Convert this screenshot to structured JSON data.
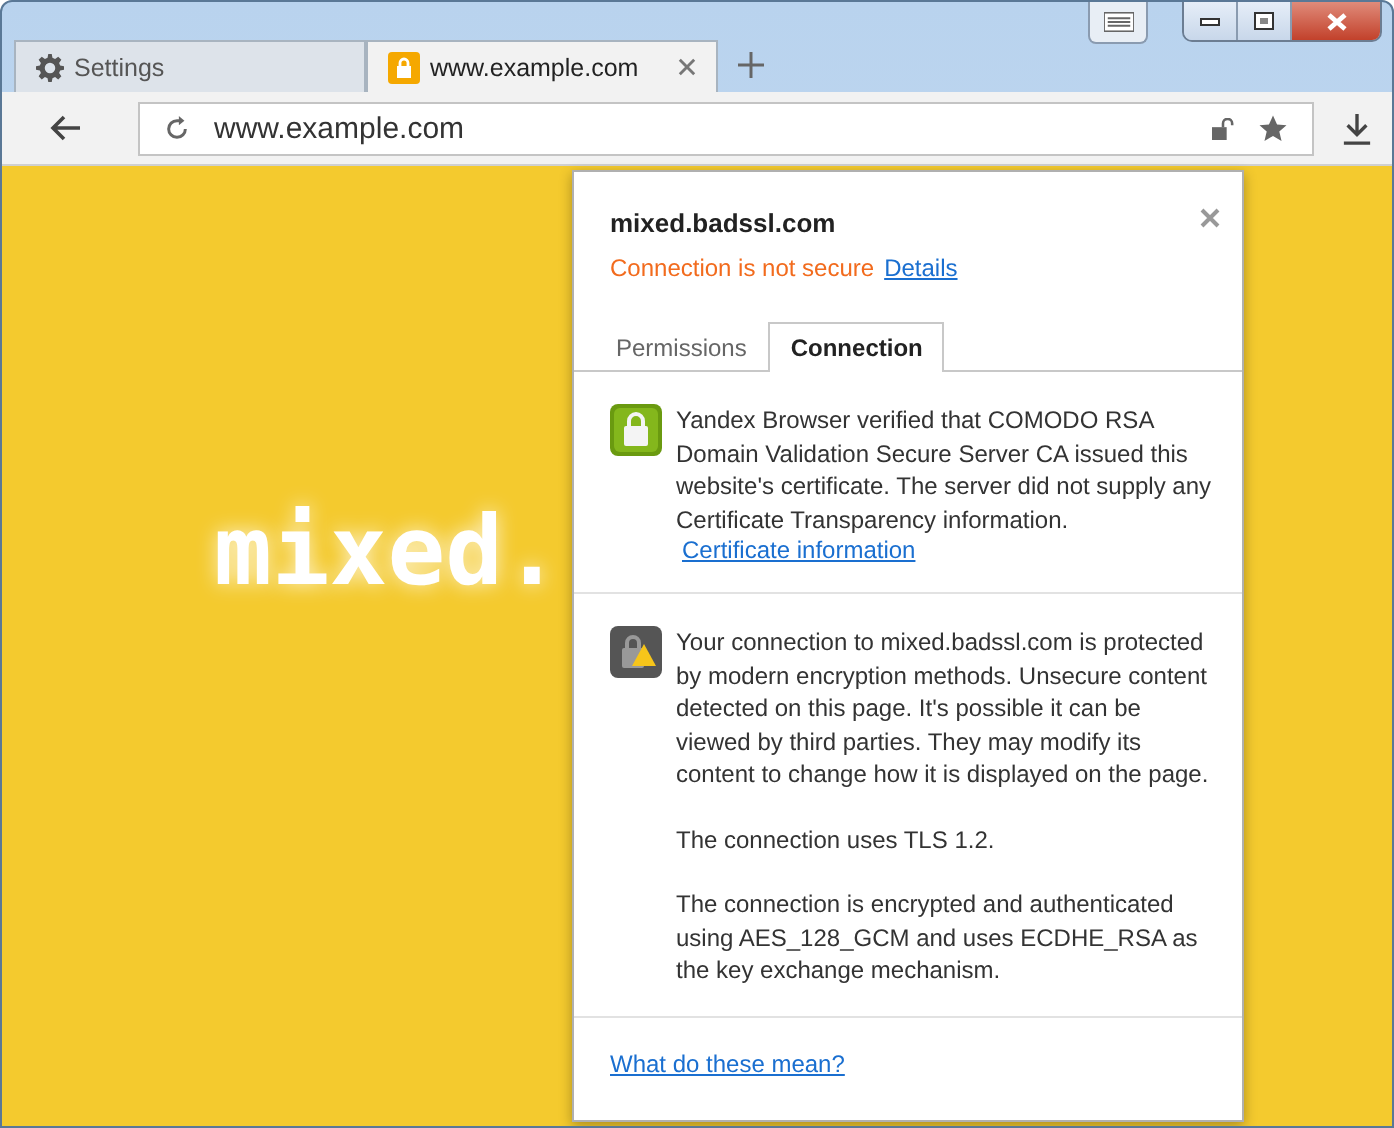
{
  "tabs": [
    {
      "label": "Settings",
      "kind": "settings",
      "selected": false,
      "closable": false
    },
    {
      "label": "www.example.com",
      "kind": "secure",
      "selected": true,
      "closable": true
    }
  ],
  "address_bar": {
    "value": "www.example.com"
  },
  "page": {
    "heading": "mixed."
  },
  "popup": {
    "host": "mixed.badssl.com",
    "status": "Connection is not secure",
    "details_link": "Details",
    "tabs": [
      {
        "label": "Permissions",
        "selected": false
      },
      {
        "label": "Connection",
        "selected": true
      }
    ],
    "sections": [
      {
        "kind": "verified",
        "text": "Yandex Browser verified that COMODO RSA Domain Validation Secure Server CA issued this website's certificate. The server did not supply any Certificate Transparency information.",
        "link": "Certificate information"
      },
      {
        "kind": "warning",
        "paragraphs": [
          "Your connection to mixed.badssl.com is protected by modern encryption methods. Unsecure content detected on this page. It's possible it can be viewed by third parties. They may modify its content to change how it is displayed on the page.",
          "The connection uses TLS 1.2.",
          "The connection is encrypted and authenticated using AES_128_GCM and uses ECDHE_RSA as the key exchange mechanism."
        ]
      }
    ],
    "footer_link": "What do these mean?"
  }
}
